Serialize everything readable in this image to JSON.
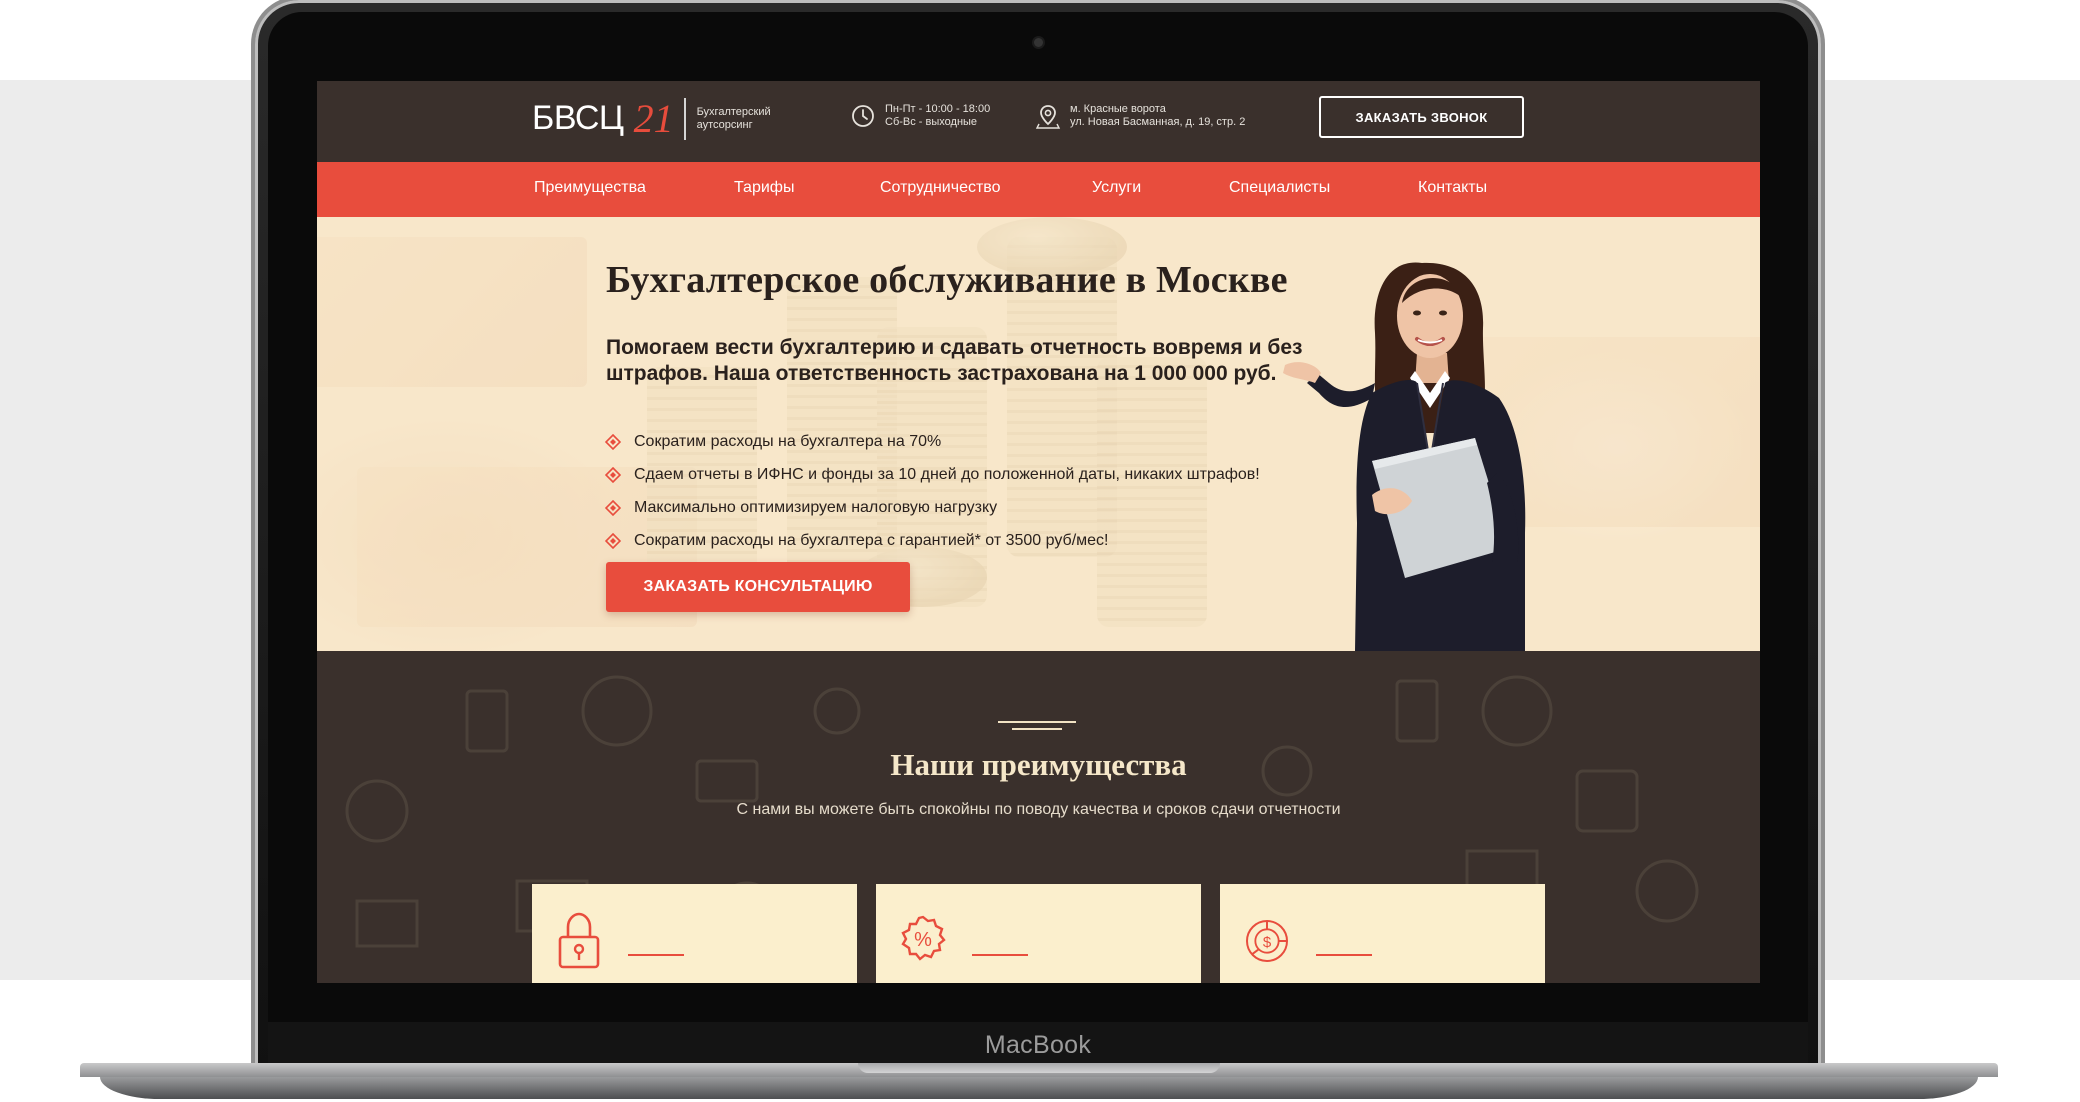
{
  "device": {
    "brand_label": "MacBook"
  },
  "header": {
    "logo_text": "БВСЦ",
    "logo_number": "21",
    "logo_tagline_1": "Бухгалтерский",
    "logo_tagline_2": "аутсорсинг",
    "hours_line_1": "Пн-Пт - 10:00 - 18:00",
    "hours_line_2": "Сб-Вс - выходные",
    "address_line_1": "м. Красные ворота",
    "address_line_2": "ул. Новая Басманная, д. 19, стр. 2",
    "callback_label": "ЗАКАЗАТЬ ЗВОНОК"
  },
  "nav": {
    "items": [
      "Преимущества",
      "Тарифы",
      "Сотрудничество",
      "Услуги",
      "Специалисты",
      "Контакты"
    ]
  },
  "hero": {
    "title": "Бухгалтерское обслуживание в Москве",
    "subtitle": "Помогаем вести бухгалтерию и сдавать отчетность вовремя и без штрафов. Наша ответственность застрахована на 1 000 000 руб.",
    "bullets": [
      "Сократим расходы на бухгалтера на 70%",
      "Сдаем отчеты в ИФНС и фонды за 10 дней до положенной даты, никаких штрафов!",
      "Максимально оптимизируем налоговую нагрузку",
      "Сократим расходы на бухгалтера с гарантией* от 3500 руб/мес!"
    ],
    "cta_label": "ЗАКАЗАТЬ КОНСУЛЬТАЦИЮ"
  },
  "advantages": {
    "title": "Наши преимущества",
    "subtitle": "С нами вы можете быть спокойны по поводу качества и сроков сдачи отчетности",
    "cards": [
      {
        "icon": "lock-icon"
      },
      {
        "icon": "percent-icon"
      },
      {
        "icon": "dollar-chart-icon"
      }
    ]
  },
  "colors": {
    "accent": "#e84d3d",
    "dark": "#3a302c",
    "cream": "#fbefcd",
    "hero_bg": "#f6e3c3"
  }
}
